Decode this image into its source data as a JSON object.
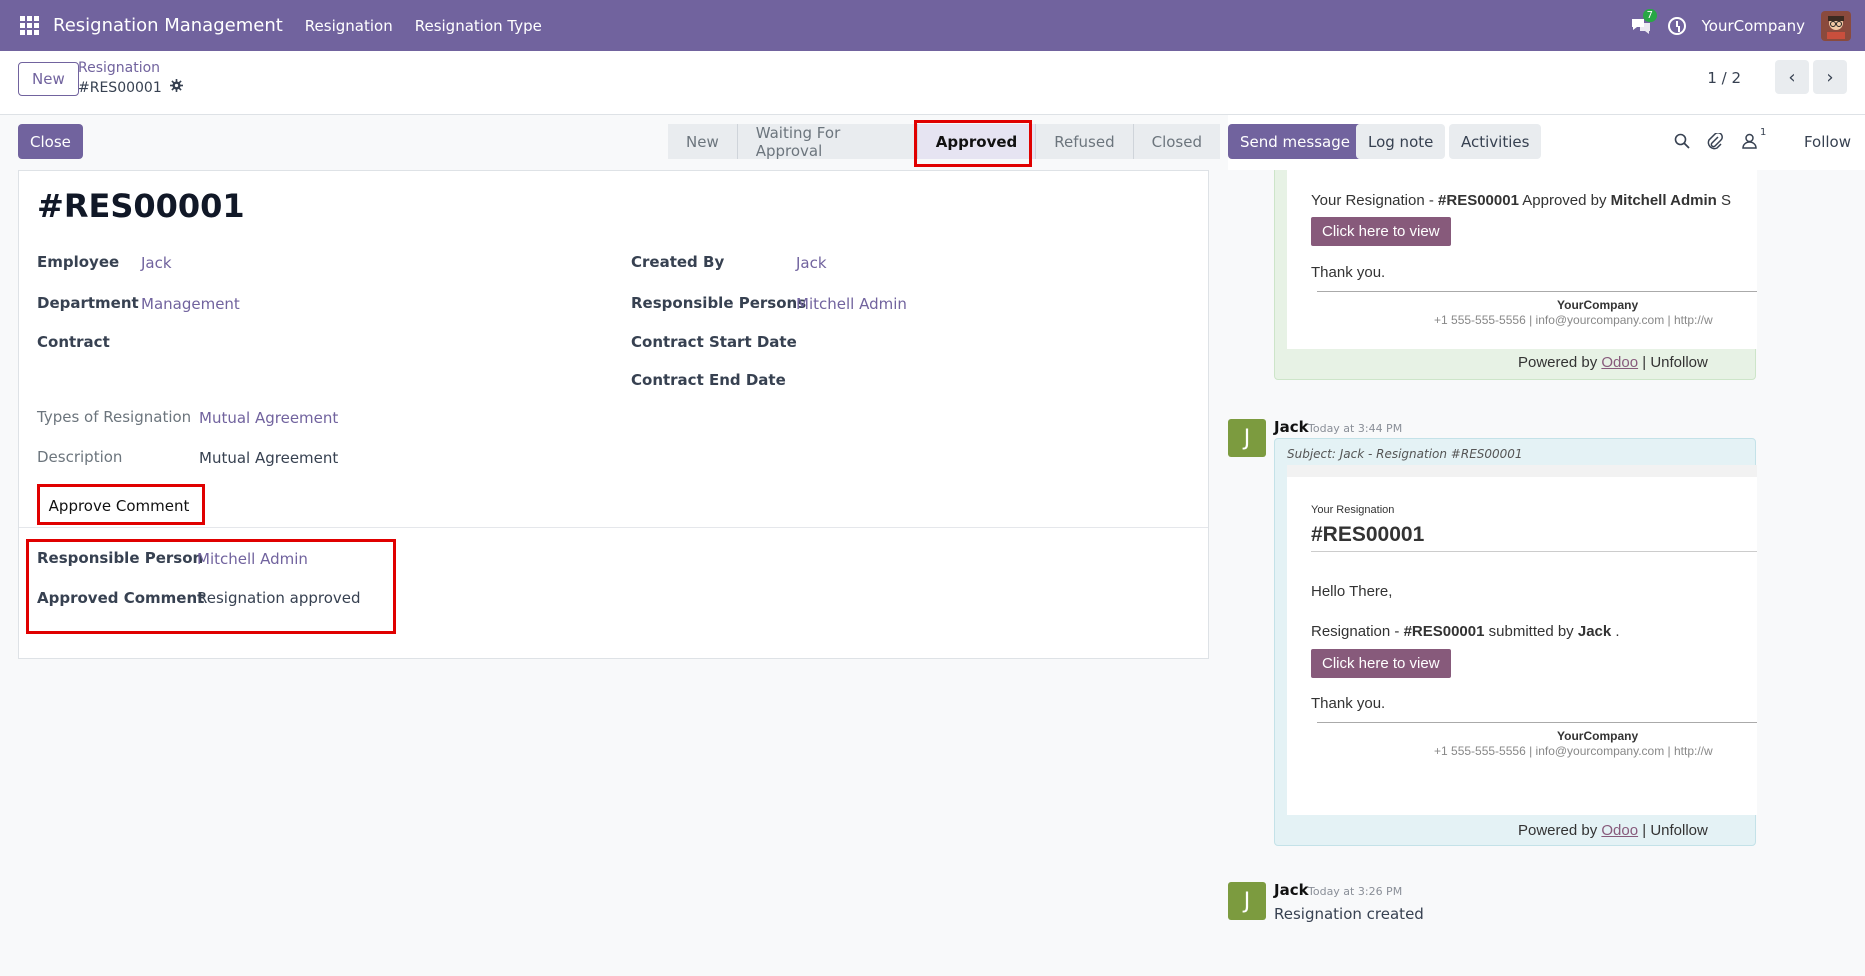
{
  "topbar": {
    "app_title": "Resignation Management",
    "menu": [
      "Resignation",
      "Resignation Type"
    ],
    "chat_badge": "7",
    "company": "YourCompany"
  },
  "control_panel": {
    "new_label": "New",
    "breadcrumb_parent": "Resignation",
    "breadcrumb_current": "#RES00001",
    "pager": "1 / 2"
  },
  "statusbar": {
    "close_label": "Close",
    "stages": [
      "New",
      "Waiting For Approval",
      "Approved",
      "Refused",
      "Closed"
    ],
    "active_stage": "Approved"
  },
  "form": {
    "title": "#RES00001",
    "employee_label": "Employee",
    "employee": "Jack",
    "department_label": "Department",
    "department": "Management",
    "contract_label": "Contract",
    "created_by_label": "Created By",
    "created_by": "Jack",
    "responsible_persons_label": "Responsible Persons",
    "responsible_persons": "Mitchell Admin",
    "contract_start_label": "Contract Start Date",
    "contract_end_label": "Contract End Date",
    "types_label": "Types of Resignation",
    "types": "Mutual Agreement",
    "description_label": "Description",
    "description": "Mutual Agreement",
    "tab_label": "Approve Comment",
    "responsible_person_label": "Responsible Person",
    "responsible_person": "Mitchell Admin",
    "approved_comment_label": "Approved Comment",
    "approved_comment": "Resignation approved"
  },
  "chatter": {
    "send_message": "Send message",
    "log_note": "Log note",
    "activities": "Activities",
    "followers_count": "1",
    "follow": "Follow",
    "msg1": {
      "line_prefix": "Your Resignation - ",
      "ref": "#RES00001",
      "approved_by": " Approved by ",
      "approver": "Mitchell Admin",
      "cutoff": " S",
      "button": "Click here to view",
      "thanks": "Thank you.",
      "company": "YourCompany",
      "contact": "+1 555-555-5556 | info@yourcompany.com | http://w",
      "powered_prefix": "Powered by ",
      "odoo": "Odoo",
      "unfollow": " | Unfollow"
    },
    "msg2": {
      "author": "Jack",
      "time": "Today at 3:44 PM",
      "subject": "Subject: Jack - Resignation #RES00001",
      "small_heading": "Your Resignation",
      "ref_big": "#RES00001",
      "hello": "Hello There,",
      "line_prefix": "Resignation - ",
      "ref": "#RES00001",
      "submitted_by": " submitted by ",
      "submitter": "Jack",
      "dot": " .",
      "button": "Click here to view",
      "thanks": "Thank you.",
      "company": "YourCompany",
      "contact": "+1 555-555-5556 | info@yourcompany.com | http://w",
      "powered_prefix": "Powered by ",
      "odoo": "Odoo",
      "unfollow": " | Unfollow"
    },
    "msg3": {
      "author": "Jack",
      "time": "Today at 3:26 PM",
      "body": "Resignation created"
    },
    "avatar_letter": "J"
  },
  "colors": {
    "brand": "#71639e",
    "highlight": "#e00000",
    "mail_button": "#875a7b"
  }
}
